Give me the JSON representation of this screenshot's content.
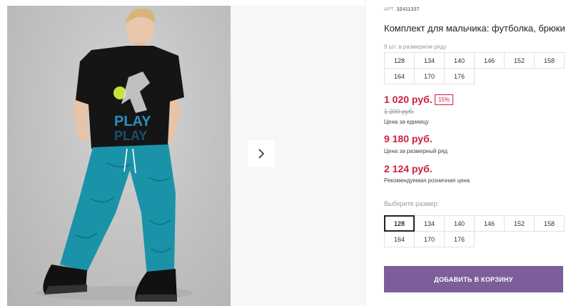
{
  "product": {
    "article_label": "АРТ.",
    "article_number": "32411337",
    "title": "Комплект для мальчика: футболка, брюки",
    "series_hint": "9 шт. в размерном ряду",
    "series_sizes": [
      "128",
      "134",
      "140",
      "146",
      "152",
      "158",
      "164",
      "170",
      "176"
    ]
  },
  "prices": {
    "unit_price": "1 020 руб.",
    "discount": "15%",
    "old_price": "1 200 руб.",
    "unit_label": "Цена за единицу",
    "series_price": "9 180 руб.",
    "series_label": "Цена за размерный ряд",
    "retail_price": "2 124 руб.",
    "retail_label": "Рекомендуемая розничная цена"
  },
  "size_picker": {
    "label": "Выберите размер:",
    "selected": "128",
    "options": [
      "128",
      "134",
      "140",
      "146",
      "152",
      "158",
      "164",
      "170",
      "176"
    ]
  },
  "actions": {
    "add_to_cart": "ДОБАВИТЬ В КОРЗИНУ",
    "next_icon": "chevron-right-icon"
  },
  "photo": {
    "shirt_print_line1": "PLAY",
    "shirt_print_line2": "PLAY"
  },
  "colors": {
    "price_red": "#d1203a",
    "button_purple": "#7b5e9a",
    "pants_teal": "#1a93a8"
  }
}
